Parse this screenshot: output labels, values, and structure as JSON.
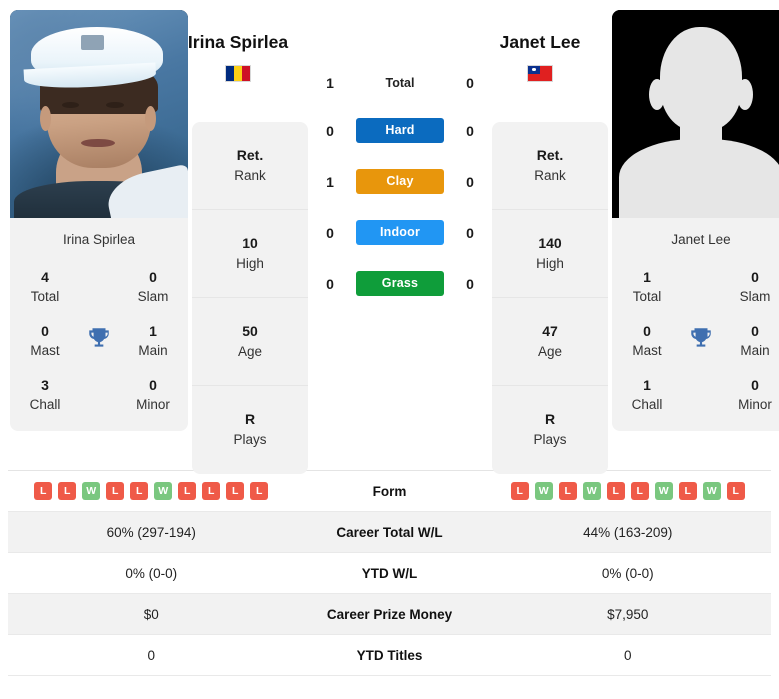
{
  "players": {
    "left": {
      "name": "Irina Spirlea",
      "photo_caption": "Irina Spirlea",
      "flag": "romania-flag",
      "rank": "Ret.",
      "rank_label": "Rank",
      "high": "10",
      "high_label": "High",
      "age": "50",
      "age_label": "Age",
      "plays": "R",
      "plays_label": "Plays",
      "titles": {
        "total": "4",
        "total_label": "Total",
        "slam": "0",
        "slam_label": "Slam",
        "mast": "0",
        "mast_label": "Mast",
        "main": "1",
        "main_label": "Main",
        "chall": "3",
        "chall_label": "Chall",
        "minor": "0",
        "minor_label": "Minor"
      },
      "h2h": {
        "total": "1",
        "hard": "0",
        "clay": "1",
        "indoor": "0",
        "grass": "0"
      },
      "form": [
        "L",
        "L",
        "W",
        "L",
        "L",
        "W",
        "L",
        "L",
        "L",
        "L"
      ],
      "career_total_wl": "60% (297-194)",
      "ytd_wl": "0% (0-0)",
      "career_prize_money": "$0",
      "ytd_titles": "0"
    },
    "right": {
      "name": "Janet Lee",
      "photo_caption": "Janet Lee",
      "flag": "taiwan-flag",
      "rank": "Ret.",
      "rank_label": "Rank",
      "high": "140",
      "high_label": "High",
      "age": "47",
      "age_label": "Age",
      "plays": "R",
      "plays_label": "Plays",
      "titles": {
        "total": "1",
        "total_label": "Total",
        "slam": "0",
        "slam_label": "Slam",
        "mast": "0",
        "mast_label": "Mast",
        "main": "0",
        "main_label": "Main",
        "chall": "1",
        "chall_label": "Chall",
        "minor": "0",
        "minor_label": "Minor"
      },
      "h2h": {
        "total": "0",
        "hard": "0",
        "clay": "0",
        "indoor": "0",
        "grass": "0"
      },
      "form": [
        "L",
        "W",
        "L",
        "W",
        "L",
        "L",
        "W",
        "L",
        "W",
        "L"
      ],
      "career_total_wl": "44% (163-209)",
      "ytd_wl": "0% (0-0)",
      "career_prize_money": "$7,950",
      "ytd_titles": "0"
    }
  },
  "h2h_labels": {
    "total": "Total",
    "hard": "Hard",
    "clay": "Clay",
    "indoor": "Indoor",
    "grass": "Grass"
  },
  "surface_colors": {
    "hard": "#0b6bbf",
    "clay": "#e8960c",
    "indoor": "#2196f3",
    "grass": "#0f9d3a"
  },
  "form_colors": {
    "win": "#7ac77f",
    "loss": "#ef5a48"
  },
  "trophy_color": "#3f6fb0",
  "table_labels": {
    "form": "Form",
    "career_total_wl": "Career Total W/L",
    "ytd_wl": "YTD W/L",
    "career_prize_money": "Career Prize Money",
    "ytd_titles": "YTD Titles"
  }
}
